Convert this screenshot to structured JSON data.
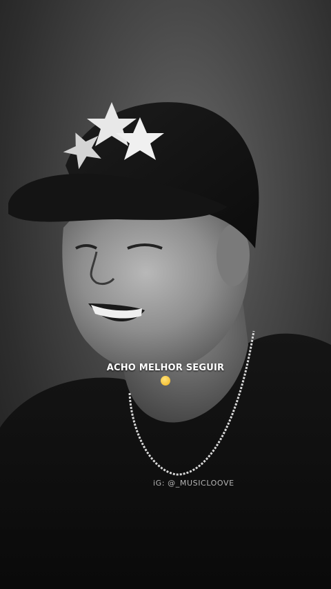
{
  "caption": {
    "text": "ACHO MELHOR SEGUIR",
    "emoji": "exhausted-face-emoji"
  },
  "watermark": {
    "text": "iG: @_MUSICLOOVE"
  },
  "photo": {
    "subject": "portrait-photo",
    "style": "black-and-white"
  }
}
